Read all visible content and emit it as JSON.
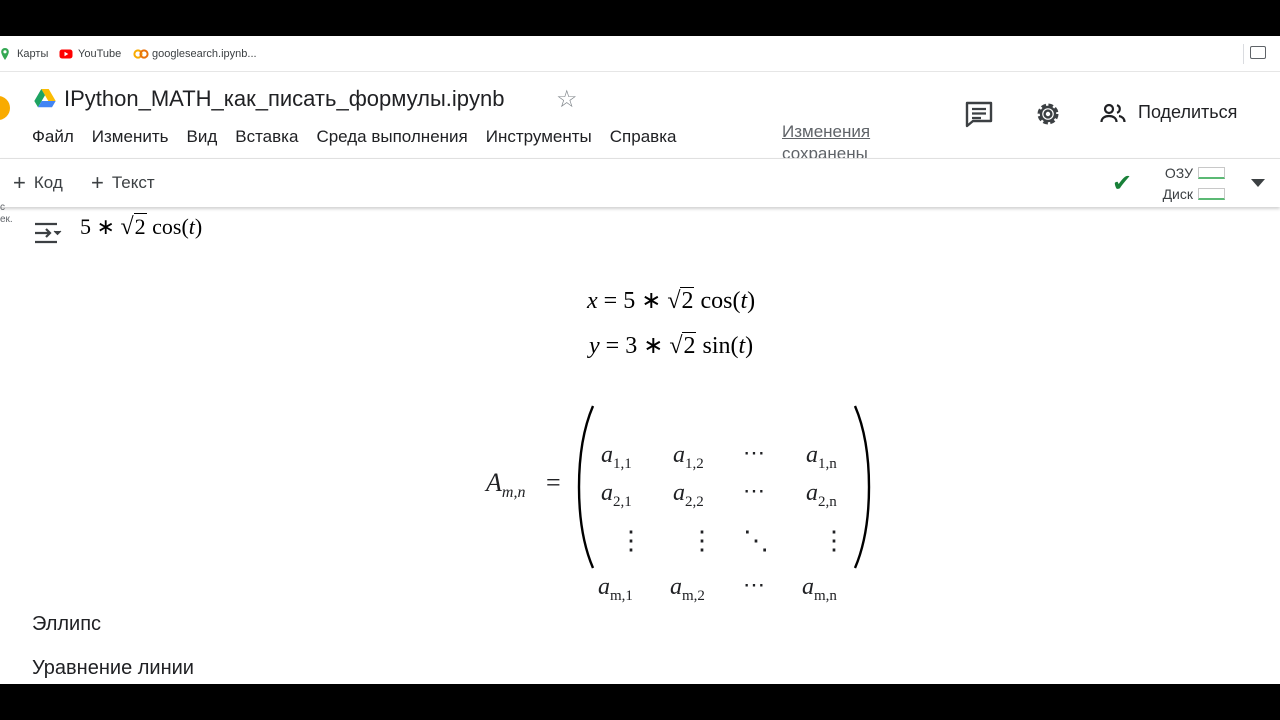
{
  "bookmarks": [
    {
      "label": "Карты",
      "icon": "maps-icon"
    },
    {
      "label": "YouTube",
      "icon": "youtube-icon"
    },
    {
      "label": "googlesearch.ipynb...",
      "icon": "colab-icon"
    }
  ],
  "notebook": {
    "title": "IPython_MATH_как_писать_формулы.ipynb",
    "save_status": "Изменения сохранены"
  },
  "menu": [
    "Файл",
    "Изменить",
    "Вид",
    "Вставка",
    "Среда выполнения",
    "Инструменты",
    "Справка"
  ],
  "header_actions": {
    "share_label": "Поделиться"
  },
  "toolbar": {
    "add_code": "Код",
    "add_text": "Текст",
    "ram_label": "ОЗУ",
    "disk_label": "Диск",
    "ram_usage_fraction": 0.05,
    "disk_usage_fraction": 0.05
  },
  "edge_text": [
    "с",
    "ек."
  ],
  "output": {
    "formula": {
      "coef": "5",
      "op": "∗",
      "rad": "2",
      "fn": "cos",
      "var": "t"
    }
  },
  "equations": [
    {
      "lhs": "x",
      "coef": "5",
      "rad": "2",
      "fn": "cos",
      "var": "t"
    },
    {
      "lhs": "y",
      "coef": "3",
      "rad": "2",
      "fn": "sin",
      "var": "t"
    }
  ],
  "matrix": {
    "name": "A",
    "subscript": "m,n",
    "entries": [
      [
        "a",
        "1,1",
        "a",
        "1,2",
        "⋯",
        "a",
        "1,n"
      ],
      [
        "a",
        "2,1",
        "a",
        "2,2",
        "⋯",
        "a",
        "2,n"
      ],
      [
        "a",
        "m,1",
        "a",
        "m,2",
        "⋯",
        "a",
        "m,n"
      ]
    ]
  },
  "text_cells": [
    "Эллипс",
    "Уравнение линии"
  ],
  "colors": {
    "accent_green": "#188038",
    "text": "#202124",
    "muted": "#5f6368"
  }
}
